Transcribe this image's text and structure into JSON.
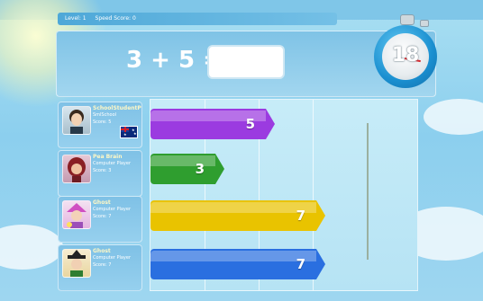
{
  "header": {
    "level_text": "Level: 1",
    "speed_text": "Speed Score: 0"
  },
  "question": {
    "equation": "3 + 5 =",
    "answer_value": ""
  },
  "timer": {
    "seconds_left": "18"
  },
  "players": [
    {
      "name": "SchoolStudentP",
      "type": "SmlSchool",
      "score_text": "Score: 5",
      "has_flag": true
    },
    {
      "name": "Pea Brain",
      "type": "Computer Player",
      "score_text": "Score: 3",
      "has_flag": false
    },
    {
      "name": "Ghost",
      "type": "Computer Player",
      "score_text": "Score: 7",
      "has_flag": false
    },
    {
      "name": "Ghost",
      "type": "Computer Player",
      "score_text": "Score: 7",
      "has_flag": false
    }
  ],
  "race": {
    "max_score": 10,
    "scores": [
      5,
      3,
      7,
      7
    ],
    "bar_colors": [
      "#9b3be0",
      "#2f9e2f",
      "#e9c300",
      "#2a6fe0"
    ]
  }
}
